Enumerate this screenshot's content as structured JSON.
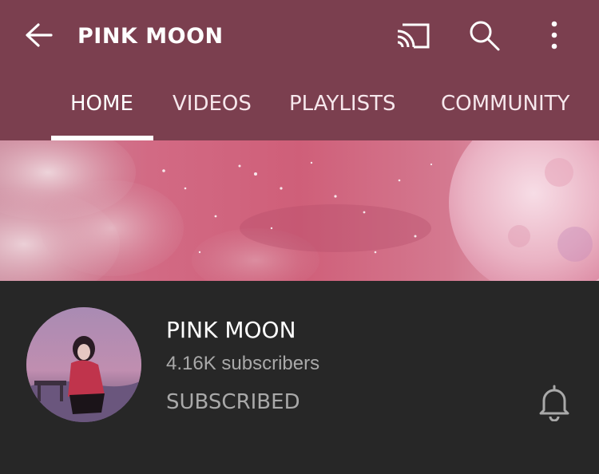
{
  "header": {
    "title": "PINK MOON",
    "icons": [
      "back-arrow-icon",
      "cast-icon",
      "search-icon",
      "more-vert-icon"
    ],
    "background_color": "#7b3f4f"
  },
  "tabs": [
    {
      "label": "HOME",
      "selected": true
    },
    {
      "label": "VIDEOS",
      "selected": false
    },
    {
      "label": "PLAYLISTS",
      "selected": false
    },
    {
      "label": "COMMUNITY",
      "selected": false
    }
  ],
  "channel": {
    "name": "PINK MOON",
    "subscribers": "4.16K subscribers",
    "subscribe_state": "SUBSCRIBED",
    "notification_icon": "bell-icon"
  },
  "colors": {
    "accent": "#7b3f4f",
    "dark_background": "#272727",
    "muted_text": "#a9a9a9"
  }
}
